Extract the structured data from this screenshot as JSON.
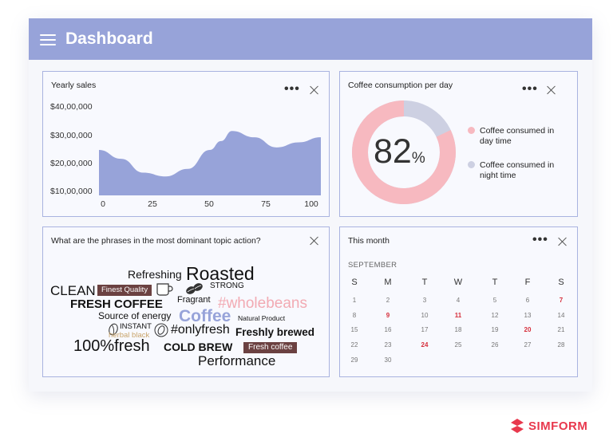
{
  "header": {
    "title": "Dashboard"
  },
  "yearly_sales": {
    "title": "Yearly sales",
    "y_ticks": [
      "$40,00,000",
      "$30,00,000",
      "$20,00,000",
      "$10,00,000"
    ],
    "x_ticks": [
      "0",
      "25",
      "50",
      "75",
      "100"
    ]
  },
  "coffee": {
    "title": "Coffee consumption per day",
    "percent": 82,
    "percent_sign": "%",
    "legend": [
      {
        "label": "Coffee consumed in day time",
        "color": "#f7b9c0"
      },
      {
        "label": "Coffee consumed in night time",
        "color": "#cdd0e2"
      }
    ]
  },
  "phrases": {
    "title": "What are the phrases in the most dominant topic action?",
    "words": [
      "Refreshing",
      "Roasted",
      "CLEAN",
      "Finest Quality",
      "STRONG",
      "FRESH COFFEE",
      "Fragrant",
      "#wholebeans",
      "Source of energy",
      "Coffee",
      "Natural Product",
      "INSTANT",
      "herbal black",
      "#onlyfresh",
      "Freshly brewed",
      "100%fresh",
      "COLD BREW",
      "Fresh coffee",
      "Performance"
    ]
  },
  "calendar": {
    "title": "This month",
    "month": "SEPTEMBER",
    "weekdays": [
      "S",
      "M",
      "T",
      "W",
      "T",
      "F",
      "S"
    ],
    "weeks": [
      [
        "1",
        "2",
        "3",
        "4",
        "5",
        "6",
        "7"
      ],
      [
        "8",
        "9",
        "10",
        "11",
        "12",
        "13",
        "14"
      ],
      [
        "15",
        "16",
        "17",
        "18",
        "19",
        "20",
        "21"
      ],
      [
        "22",
        "23",
        "24",
        "25",
        "26",
        "27",
        "28"
      ],
      [
        "29",
        "30"
      ]
    ],
    "highlighted_days": [
      "7",
      "9",
      "11",
      "20",
      "24"
    ]
  },
  "brand": {
    "name": "SIMFORM"
  },
  "chart_data": [
    {
      "type": "area",
      "title": "Yearly sales",
      "x": [
        0,
        10,
        20,
        30,
        40,
        50,
        55,
        60,
        70,
        80,
        90,
        100
      ],
      "values": [
        2800000,
        2450000,
        1900000,
        1750000,
        2050000,
        2800000,
        3150000,
        3550000,
        3300000,
        2900000,
        3100000,
        3300000
      ],
      "xlim": [
        0,
        100
      ],
      "ylim": [
        1000000,
        4000000
      ],
      "color": "#97a3d9"
    },
    {
      "type": "pie",
      "title": "Coffee consumption per day",
      "center_label": "82%",
      "series": [
        {
          "name": "Coffee consumed in day time",
          "values": [
            82
          ],
          "color": "#f7b9c0"
        },
        {
          "name": "Coffee consumed in night time",
          "values": [
            18
          ],
          "color": "#cdd0e2"
        }
      ]
    }
  ]
}
